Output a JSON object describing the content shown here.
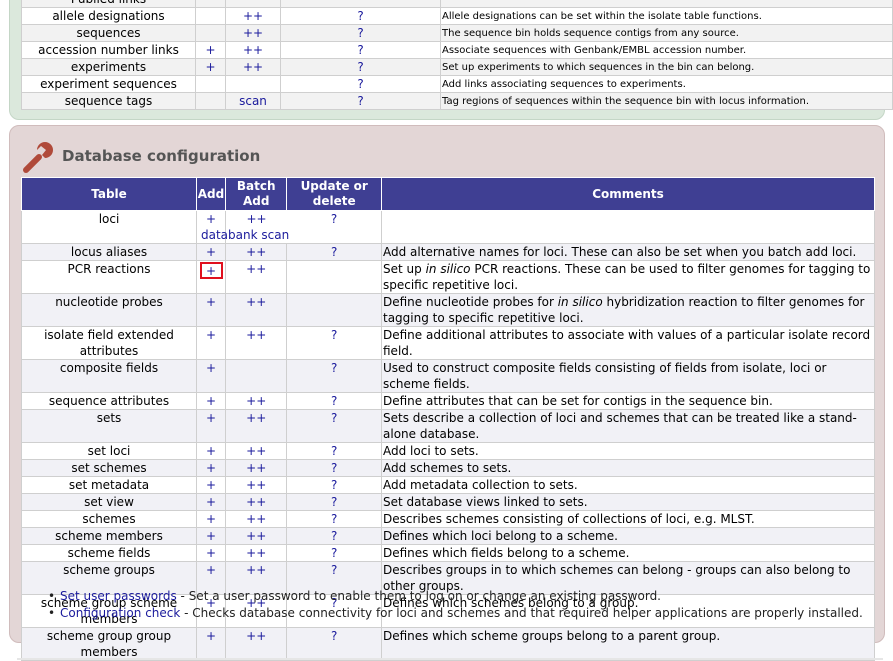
{
  "top_rows": [
    {
      "name": "Publied links",
      "add": "",
      "batch": "",
      "update": "",
      "comment": ""
    },
    {
      "name": "allele designations",
      "add": "",
      "batch": "++",
      "update": "?",
      "comment": "Allele designations can be set within the isolate table functions."
    },
    {
      "name": "sequences",
      "add": "",
      "batch": "++",
      "update": "?",
      "comment": "The sequence bin holds sequence contigs from any source."
    },
    {
      "name": "accession number links",
      "add": "+",
      "batch": "++",
      "update": "?",
      "comment": "Associate sequences with Genbank/EMBL accession number."
    },
    {
      "name": "experiments",
      "add": "+",
      "batch": "++",
      "update": "?",
      "comment": "Set up experiments to which sequences in the bin can belong."
    },
    {
      "name": "experiment sequences",
      "add": "",
      "batch": "",
      "update": "?",
      "comment": "Add links associating sequences to experiments."
    },
    {
      "name": "sequence tags",
      "add": "",
      "batch": "scan",
      "update": "?",
      "comment": "Tag regions of sequences within the sequence bin with locus information."
    }
  ],
  "db_config": {
    "title": "Database configuration",
    "headers": {
      "table": "Table",
      "add": "Add",
      "batch": "Batch Add",
      "update": "Update or delete",
      "comments": "Comments"
    },
    "loci_row": {
      "name": "loci",
      "add": "+",
      "batch": "++",
      "update": "?",
      "extra": "databank scan",
      "comment": ""
    },
    "rows": [
      {
        "name": "locus aliases",
        "add": "+",
        "batch": "++",
        "update": "?",
        "comment": "Add alternative names for loci. These can also be set when you batch add loci."
      },
      {
        "name": "PCR reactions",
        "add": "+",
        "batch": "++",
        "update": "",
        "comment_pre": "Set up ",
        "comment_em": "in silico",
        "comment_post": " PCR reactions. These can be used to filter genomes for tagging to specific repetitive loci.",
        "highlight": true
      },
      {
        "name": "nucleotide probes",
        "add": "+",
        "batch": "++",
        "update": "",
        "comment_pre": "Define nucleotide probes for ",
        "comment_em": "in silico",
        "comment_post": " hybridization reaction to filter genomes for tagging to specific repetitive loci."
      },
      {
        "name": "isolate field extended attributes",
        "add": "+",
        "batch": "++",
        "update": "?",
        "comment": "Define additional attributes to associate with values of a particular isolate record field."
      },
      {
        "name": "composite fields",
        "add": "+",
        "batch": "",
        "update": "?",
        "comment": "Used to construct composite fields consisting of fields from isolate, loci or scheme fields."
      },
      {
        "name": "sequence attributes",
        "add": "+",
        "batch": "++",
        "update": "?",
        "comment": "Define attributes that can be set for contigs in the sequence bin."
      },
      {
        "name": "sets",
        "add": "+",
        "batch": "++",
        "update": "?",
        "comment": "Sets describe a collection of loci and schemes that can be treated like a stand-alone database."
      },
      {
        "name": "set loci",
        "add": "+",
        "batch": "++",
        "update": "?",
        "comment": "Add loci to sets."
      },
      {
        "name": "set schemes",
        "add": "+",
        "batch": "++",
        "update": "?",
        "comment": "Add schemes to sets."
      },
      {
        "name": "set metadata",
        "add": "+",
        "batch": "++",
        "update": "?",
        "comment": "Add metadata collection to sets."
      },
      {
        "name": "set view",
        "add": "+",
        "batch": "++",
        "update": "?",
        "comment": "Set database views linked to sets."
      },
      {
        "name": "schemes",
        "add": "+",
        "batch": "++",
        "update": "?",
        "comment": "Describes schemes consisting of collections of loci, e.g. MLST."
      },
      {
        "name": "scheme members",
        "add": "+",
        "batch": "++",
        "update": "?",
        "comment": "Defines which loci belong to a scheme."
      },
      {
        "name": "scheme fields",
        "add": "+",
        "batch": "++",
        "update": "?",
        "comment": "Defines which fields belong to a scheme."
      },
      {
        "name": "scheme groups",
        "add": "+",
        "batch": "++",
        "update": "?",
        "comment": "Describes groups in to which schemes can belong - groups can also belong to other groups."
      },
      {
        "name": "scheme group scheme members",
        "add": "+",
        "batch": "++",
        "update": "?",
        "comment": "Defines which schemes belong to a group."
      },
      {
        "name": "scheme group group members",
        "add": "+",
        "batch": "++",
        "update": "?",
        "comment": "Defines which scheme groups belong to a parent group."
      }
    ]
  },
  "links": [
    {
      "label": "Set user passwords",
      "text": " - Set a user password to enable them to log on or change an existing password."
    },
    {
      "label": "Configuration check",
      "text": " - Checks database connectivity for loci and schemes and that required helper applications are properly installed."
    }
  ],
  "colors": {
    "header_bg": "#3f3f93",
    "highlight": "#e0101e",
    "link": "#1a1a9c",
    "top_panel": "#dbe8dc",
    "config_panel": "#e3d6d6"
  },
  "icons": {
    "section_icon": "wrench-icon"
  }
}
